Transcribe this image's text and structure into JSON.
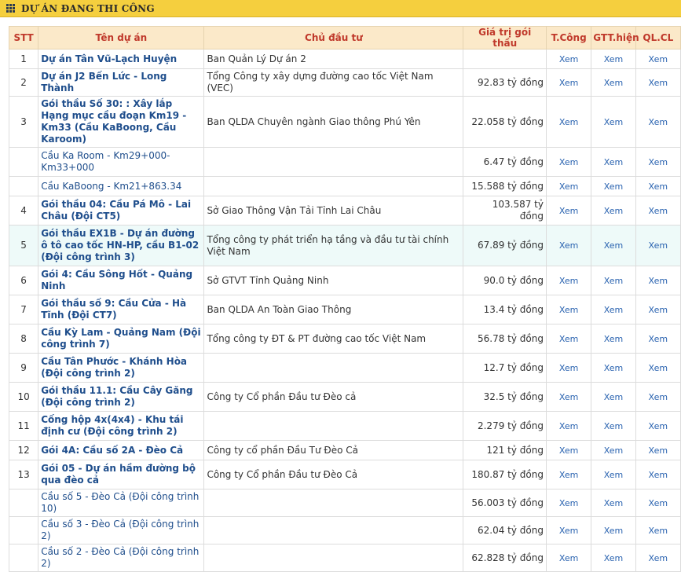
{
  "panel": {
    "title": "DỰ ÁN ĐANG THI CÔNG",
    "icon": "grid-icon"
  },
  "columns": [
    "STT",
    "Tên dự án",
    "Chủ đầu tư",
    "Giá trị gói thầu",
    "T.Công",
    "GTT.hiện",
    "QL.CL"
  ],
  "rows": [
    {
      "stt": "1",
      "name": "Dự án Tân Vũ-Lạch Huyện",
      "owner": "Ban Quản Lý Dự án 2",
      "value": "",
      "c1": "Xem",
      "c2": "Xem",
      "c3": "Xem"
    },
    {
      "stt": "2",
      "name": "Dự án J2 Bến Lức - Long Thành",
      "owner": "Tổng Công ty xây dựng đường cao tốc Việt Nam (VEC)",
      "value": "92.83 tỷ đồng",
      "c1": "Xem",
      "c2": "Xem",
      "c3": "Xem"
    },
    {
      "stt": "3",
      "name": "Gói thầu Số 30: : Xây lắp Hạng mục cầu đoạn Km19 - Km33 (Cầu KaBoong, Cầu Karoom)",
      "owner": "Ban QLDA Chuyên ngành Giao thông Phú Yên",
      "value": "22.058 tỷ đồng",
      "c1": "Xem",
      "c2": "Xem",
      "c3": "Xem"
    },
    {
      "stt": "",
      "name": "Cầu Ka Room - Km29+000-Km33+000",
      "owner": "",
      "value": "6.47 tỷ đồng",
      "c1": "Xem",
      "c2": "Xem",
      "c3": "Xem"
    },
    {
      "stt": "",
      "name": "Cầu KaBoong - Km21+863.34",
      "owner": "",
      "value": "15.588 tỷ đồng",
      "c1": "Xem",
      "c2": "Xem",
      "c3": "Xem"
    },
    {
      "stt": "4",
      "name": "Gói thầu 04: Cầu Pá Mô - Lai Châu (Đội CT5)",
      "owner": "Sở Giao Thông Vận Tải Tỉnh Lai Châu",
      "value": "103.587 tỷ đồng",
      "c1": "Xem",
      "c2": "Xem",
      "c3": "Xem"
    },
    {
      "stt": "5",
      "name": "Gói thầu EX1B - Dự án đường ô tô cao tốc HN-HP, cầu B1-02 (Đội công trình 3)",
      "owner": "Tổng công ty phát triển hạ tầng và đầu tư tài chính Việt Nam",
      "value": "67.89 tỷ đồng",
      "c1": "Xem",
      "c2": "Xem",
      "c3": "Xem"
    },
    {
      "stt": "6",
      "name": "Gói 4: Cầu Sông Hốt - Quảng Ninh",
      "owner": "Sở GTVT Tỉnh Quảng Ninh",
      "value": "90.0 tỷ đồng",
      "c1": "Xem",
      "c2": "Xem",
      "c3": "Xem"
    },
    {
      "stt": "7",
      "name": "Gói thầu số 9: Cầu Cửa - Hà Tĩnh (Đội CT7)",
      "owner": "Ban QLDA An Toàn Giao Thông",
      "value": "13.4 tỷ đồng",
      "c1": "Xem",
      "c2": "Xem",
      "c3": "Xem"
    },
    {
      "stt": "8",
      "name": "Cầu Kỳ Lam - Quảng Nam (Đội công trình 7)",
      "owner": "Tổng công ty ĐT & PT đường cao tốc Việt Nam",
      "value": "56.78 tỷ đồng",
      "c1": "Xem",
      "c2": "Xem",
      "c3": "Xem"
    },
    {
      "stt": "9",
      "name": "Cầu Tân Phước - Khánh Hòa (Đội công trình 2)",
      "owner": "",
      "value": "12.7 tỷ đồng",
      "c1": "Xem",
      "c2": "Xem",
      "c3": "Xem"
    },
    {
      "stt": "10",
      "name": "Gói thầu 11.1: Cầu Cây Găng (Đội công trình 2)",
      "owner": "Công ty Cổ phần Đầu tư Đèo cả",
      "value": "32.5 tỷ đồng",
      "c1": "Xem",
      "c2": "Xem",
      "c3": "Xem"
    },
    {
      "stt": "11",
      "name": "Cống hộp 4x(4x4) - Khu tái định cư (Đội công trình 2)",
      "owner": "",
      "value": "2.279 tỷ đồng",
      "c1": "Xem",
      "c2": "Xem",
      "c3": "Xem"
    },
    {
      "stt": "12",
      "name": "Gói 4A: Cầu số 2A - Đèo Cả",
      "owner": "Công ty cổ phần Đầu Tư Đèo Cả",
      "value": "121 tỷ đồng",
      "c1": "Xem",
      "c2": "Xem",
      "c3": "Xem"
    },
    {
      "stt": "13",
      "name": "Gói 05 - Dự án hầm đường bộ qua đèo cả",
      "owner": "Công ty Cổ phần Đầu tư Đèo Cả",
      "value": "180.87 tỷ đồng",
      "c1": "Xem",
      "c2": "Xem",
      "c3": "Xem"
    },
    {
      "stt": "",
      "name": "Cầu số 5 - Đèo Cả (Đội công trình 10)",
      "owner": "",
      "value": "56.003 tỷ đồng",
      "c1": "Xem",
      "c2": "Xem",
      "c3": "Xem"
    },
    {
      "stt": "",
      "name": "Cầu số 3 - Đèo Cả (Đội công trình 2)",
      "owner": "",
      "value": "62.04 tỷ đồng",
      "c1": "Xem",
      "c2": "Xem",
      "c3": "Xem"
    },
    {
      "stt": "",
      "name": "Cầu số 2 - Đèo Cả (Đội công trình 2)",
      "owner": "",
      "value": "62.828 tỷ đồng",
      "c1": "Xem",
      "c2": "Xem",
      "c3": "Xem"
    }
  ]
}
